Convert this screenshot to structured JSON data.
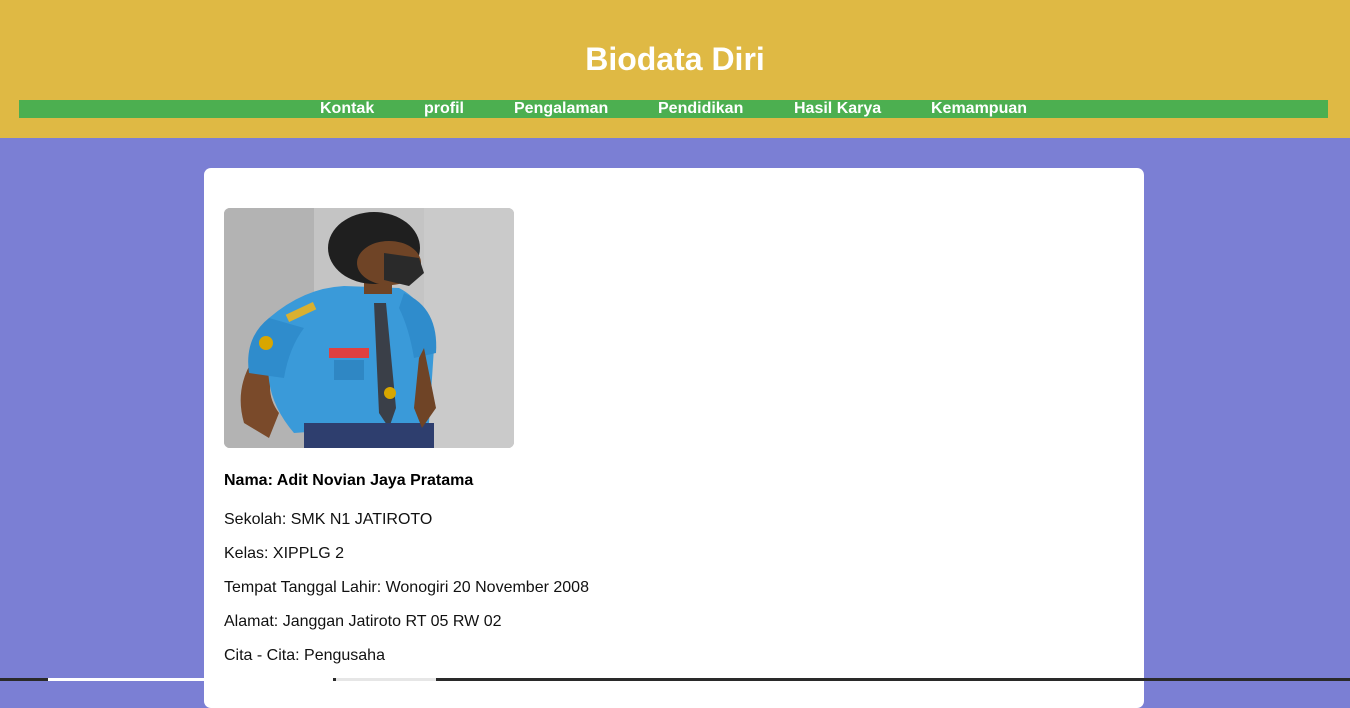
{
  "header": {
    "title": "Biodata Diri",
    "background": "#dfb944"
  },
  "nav": {
    "background": "#4caf50",
    "items": [
      "Kontak",
      "profil",
      "Pengalaman",
      "Pendidikan",
      "Hasil Karya",
      "Kemampuan"
    ]
  },
  "profile": {
    "nama": "Nama: Adit Novian Jaya Pratama",
    "sekolah": "Sekolah: SMK N1 JATIROTO",
    "kelas": "Kelas: XIPPLG 2",
    "ttl": "Tempat Tanggal Lahir: Wonogiri 20 November 2008",
    "alamat": "Alamat: Janggan Jatiroto RT 05 RW 02",
    "cita": "Cita - Cita: Pengusaha"
  },
  "colors": {
    "page_background": "#7b7fd4",
    "card_background": "#ffffff"
  }
}
